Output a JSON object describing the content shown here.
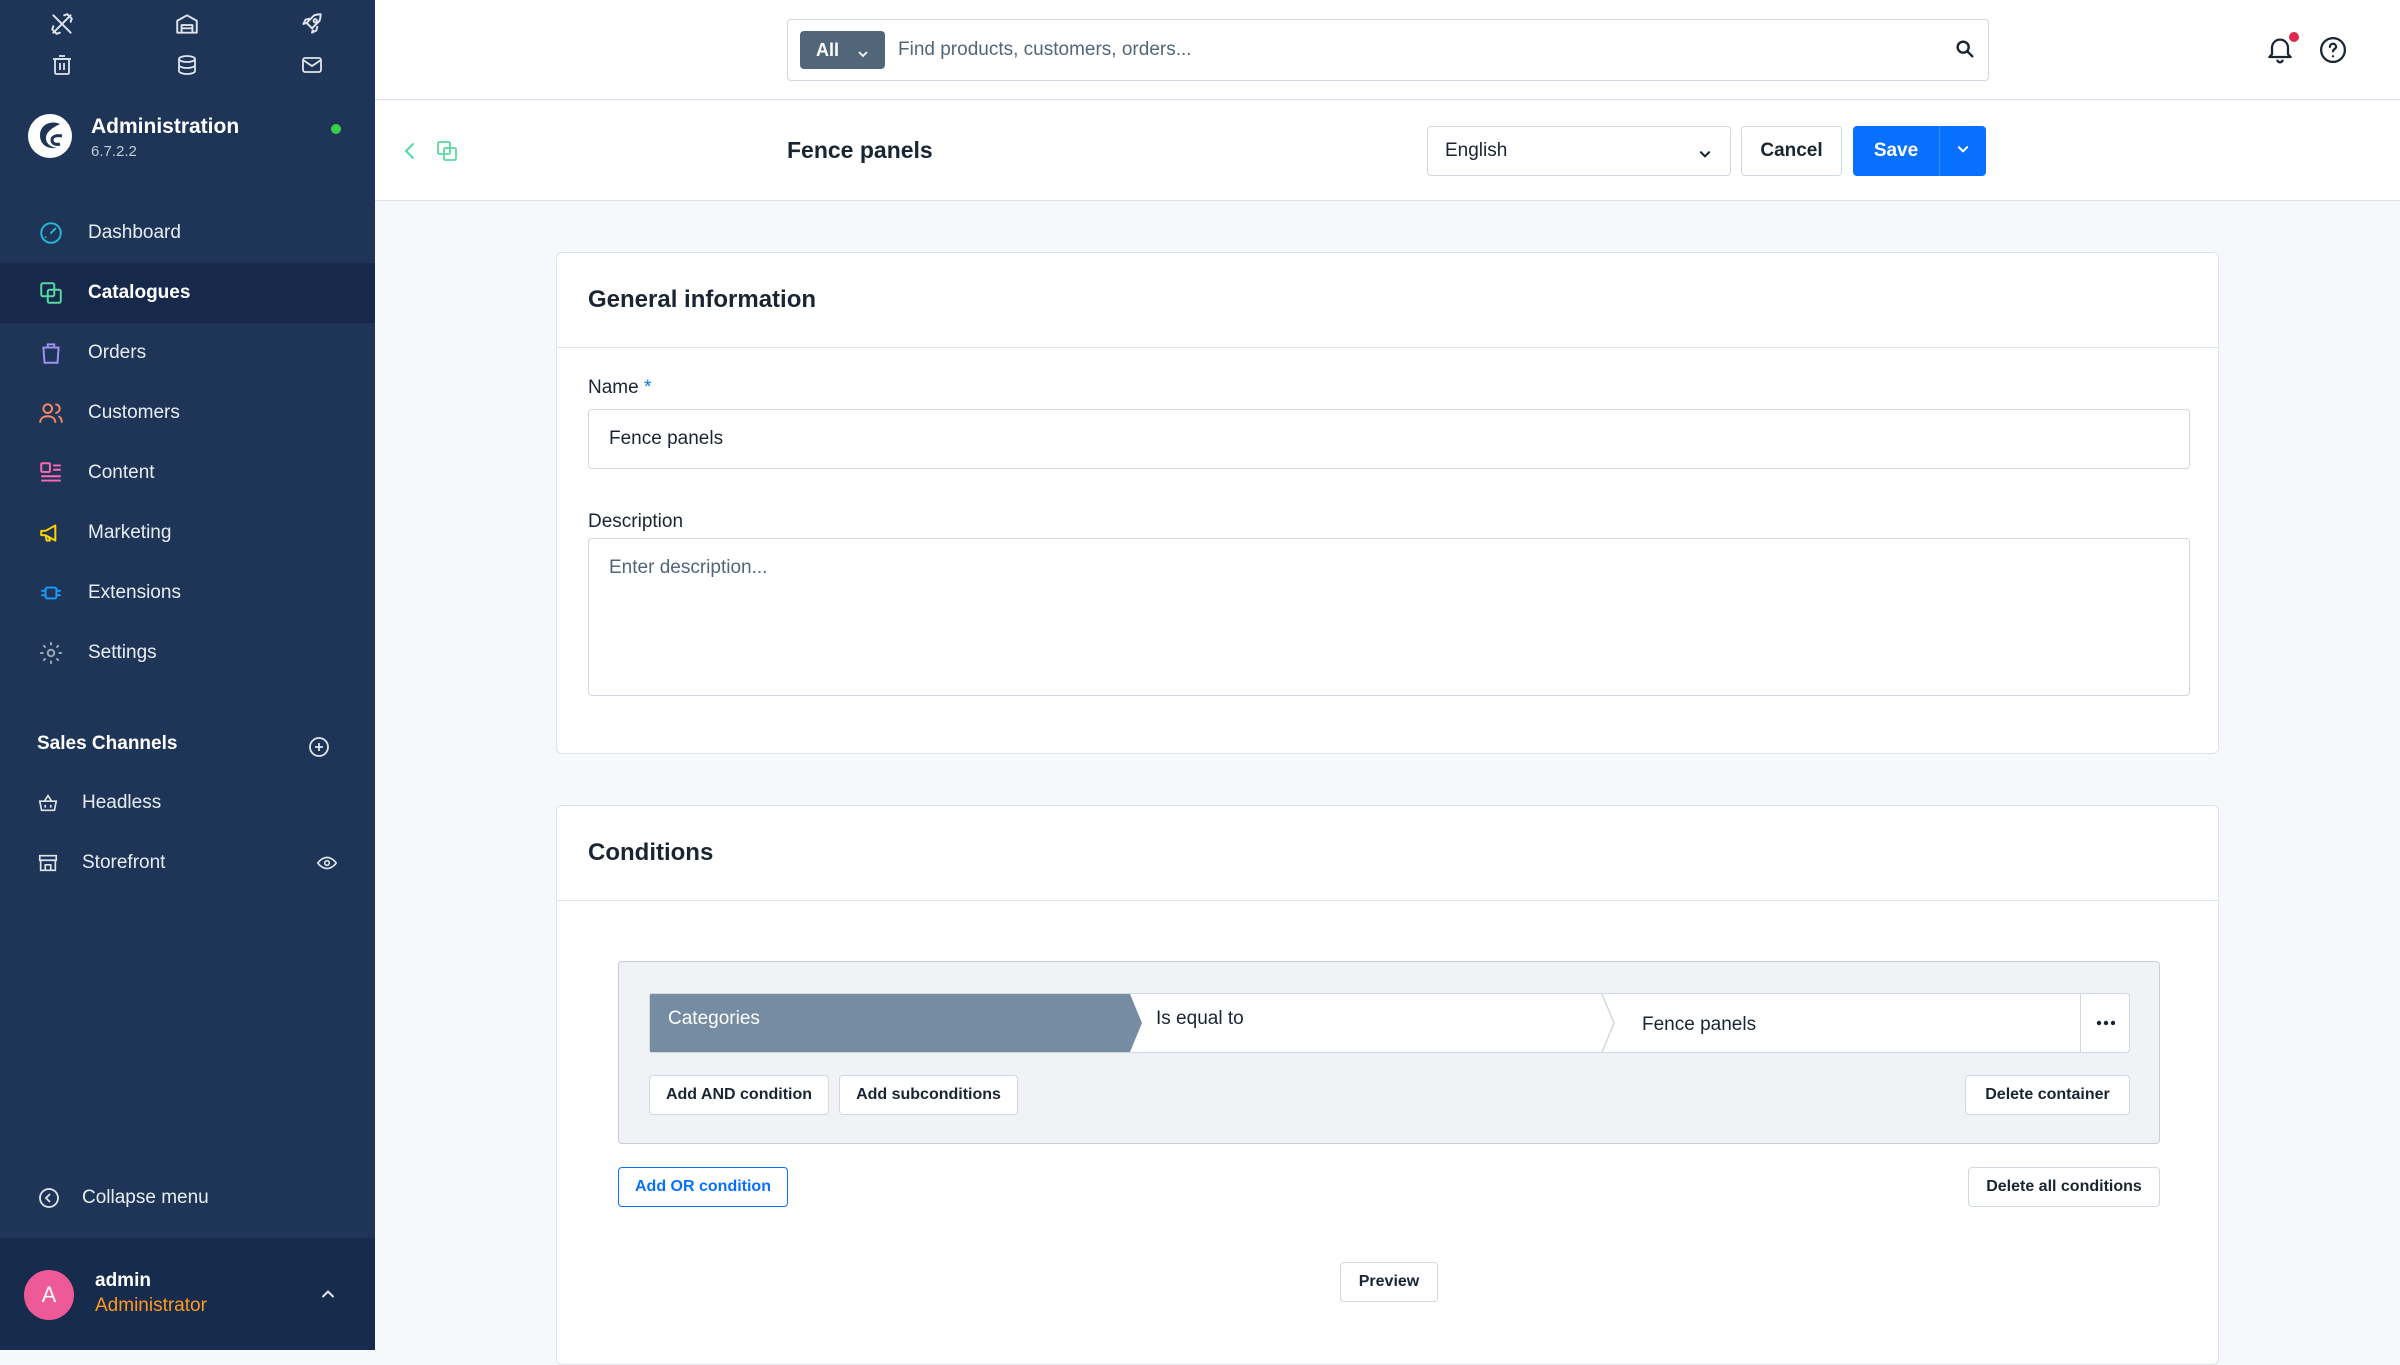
{
  "app": {
    "title": "Administration",
    "version": "6.7.2.2"
  },
  "sidebar": {
    "nav": [
      {
        "label": "Dashboard",
        "icon": "gauge-icon",
        "color": "#26b6d6"
      },
      {
        "label": "Catalogues",
        "icon": "catalogue-icon",
        "color": "#57d9a3",
        "active": true
      },
      {
        "label": "Orders",
        "icon": "shopping-bag-icon",
        "color": "#a092f0"
      },
      {
        "label": "Customers",
        "icon": "users-icon",
        "color": "#f88962"
      },
      {
        "label": "Content",
        "icon": "content-icon",
        "color": "#ff68b4"
      },
      {
        "label": "Marketing",
        "icon": "megaphone-icon",
        "color": "#ffd700"
      },
      {
        "label": "Extensions",
        "icon": "plug-icon",
        "color": "#189eff"
      },
      {
        "label": "Settings",
        "icon": "gear-icon",
        "color": "#9aa8b5"
      }
    ],
    "sales_channels": {
      "title": "Sales Channels",
      "items": [
        {
          "label": "Headless",
          "icon": "basket-icon"
        },
        {
          "label": "Storefront",
          "icon": "storefront-icon"
        }
      ]
    },
    "collapse_label": "Collapse menu",
    "user": {
      "initial": "A",
      "name": "admin",
      "role": "Administrator"
    }
  },
  "topbar": {
    "search": {
      "type": "All",
      "placeholder": "Find products, customers, orders..."
    }
  },
  "smartbar": {
    "title": "Fence panels",
    "language": "English",
    "cancel_label": "Cancel",
    "save_label": "Save"
  },
  "general": {
    "title": "General information",
    "name_label": "Name",
    "name_required": "*",
    "name_value": "Fence panels",
    "description_label": "Description",
    "description_placeholder": "Enter description..."
  },
  "conditions": {
    "title": "Conditions",
    "rows": [
      {
        "field": "Categories",
        "operator": "Is equal to",
        "value": "Fence panels"
      }
    ],
    "add_and_label": "Add AND condition",
    "add_sub_label": "Add subconditions",
    "delete_container_label": "Delete container",
    "add_or_label": "Add OR condition",
    "delete_all_label": "Delete all conditions",
    "preview_label": "Preview"
  },
  "colors": {
    "sidebar_bg": "#1f3557",
    "sidebar_active": "#17294a",
    "primary": "#0870ff",
    "condition_field_bg": "#758ca3",
    "notification_dot": "#de294c",
    "status_online": "#37d046",
    "avatar_bg": "#ee5a97",
    "user_role": "#ff9a1f"
  }
}
